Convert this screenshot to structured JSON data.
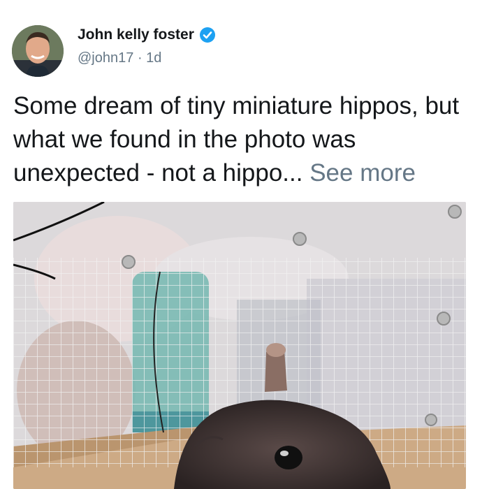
{
  "author": {
    "display_name": "John kelly foster",
    "handle": "@john17",
    "separator": "·",
    "time_ago": "1d",
    "verified": true
  },
  "tweet": {
    "text": "Some dream of tiny miniature hippos, but what we found in the photo was unexpected - not a hippo...",
    "see_more_label": "See more"
  },
  "colors": {
    "verified_blue": "#1da1f2",
    "meta_gray": "#657786",
    "text_dark": "#14171a"
  },
  "icons": {
    "verified": "verified-badge-icon"
  }
}
